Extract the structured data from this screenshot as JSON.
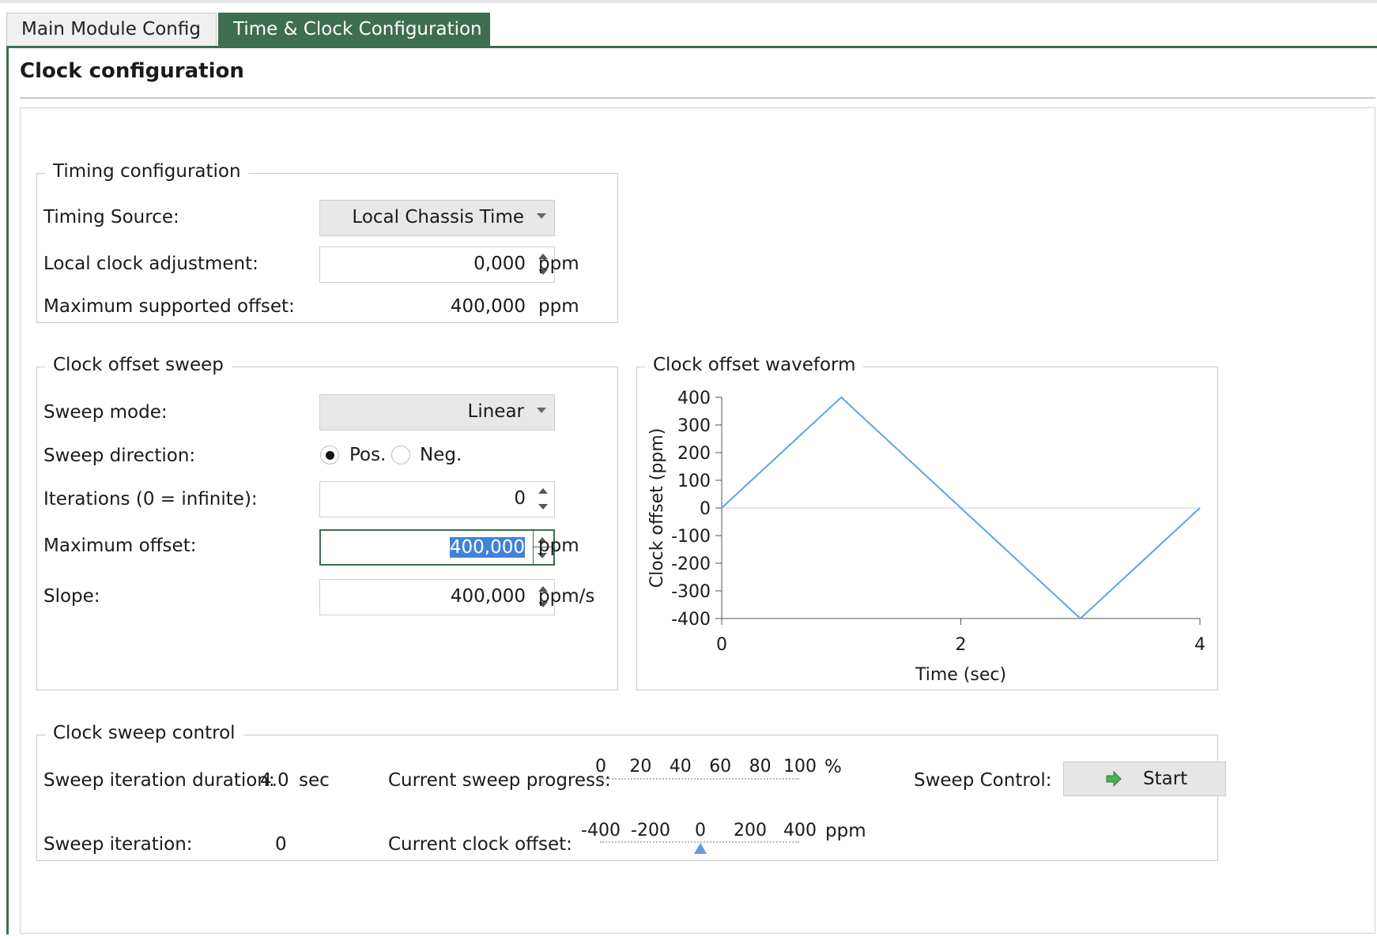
{
  "tabs": [
    {
      "label": "Main Module Config",
      "active": false
    },
    {
      "label": "Time & Clock Configuration",
      "active": true
    }
  ],
  "panel_title": "Clock configuration",
  "timing": {
    "legend": "Timing configuration",
    "source_label": "Timing Source:",
    "source_value": "Local Chassis Time",
    "adjust_label": "Local clock adjustment:",
    "adjust_value": "0,000",
    "adjust_unit": "ppm",
    "max_label": "Maximum supported offset:",
    "max_value": "400,000",
    "max_unit": "ppm"
  },
  "sweep": {
    "legend": "Clock offset sweep",
    "mode_label": "Sweep mode:",
    "mode_value": "Linear",
    "direction_label": "Sweep direction:",
    "dir_pos": "Pos.",
    "dir_neg": "Neg.",
    "dir_selected": "Pos.",
    "iter_label": "Iterations (0 = infinite):",
    "iter_value": "0",
    "maxoff_label": "Maximum offset:",
    "maxoff_value": "400,000",
    "maxoff_unit": "ppm",
    "slope_label": "Slope:",
    "slope_value": "400,000",
    "slope_unit": "ppm/s"
  },
  "waveform": {
    "legend": "Clock offset waveform"
  },
  "chart_data": {
    "type": "line",
    "xlabel": "Time (sec)",
    "ylabel": "Clock offset (ppm)",
    "xlim": [
      0,
      4
    ],
    "ylim": [
      -400,
      400
    ],
    "xticks": [
      0,
      2,
      4
    ],
    "yticks": [
      400,
      300,
      200,
      100,
      0,
      -100,
      -200,
      -300,
      -400
    ],
    "series": [
      {
        "x": [
          0,
          1,
          3,
          4
        ],
        "y": [
          0,
          400,
          -400,
          0
        ]
      }
    ],
    "colors": {
      "line": "#5fa3e8",
      "zero_line": "#e6e6e6",
      "axis": "#555555"
    }
  },
  "control": {
    "legend": "Clock sweep control",
    "duration_label": "Sweep iteration duration:",
    "duration_value": "4.0",
    "duration_unit": "sec",
    "iteration_label": "Sweep iteration:",
    "iteration_value": "0",
    "progress_label": "Current sweep progress:",
    "progress_ticks": [
      "0",
      "20",
      "40",
      "60",
      "80",
      "100"
    ],
    "progress_unit": "%",
    "progress_value": 0,
    "offset_label": "Current clock offset:",
    "offset_ticks": [
      "-400",
      "-200",
      "0",
      "200",
      "400"
    ],
    "offset_unit": "ppm",
    "offset_value": 0,
    "sweep_control_label": "Sweep Control:",
    "start_label": "Start"
  },
  "theme": {
    "accent": "#3d6e4f",
    "selection": "#3f83d6",
    "start_icon": "#4caf50"
  }
}
